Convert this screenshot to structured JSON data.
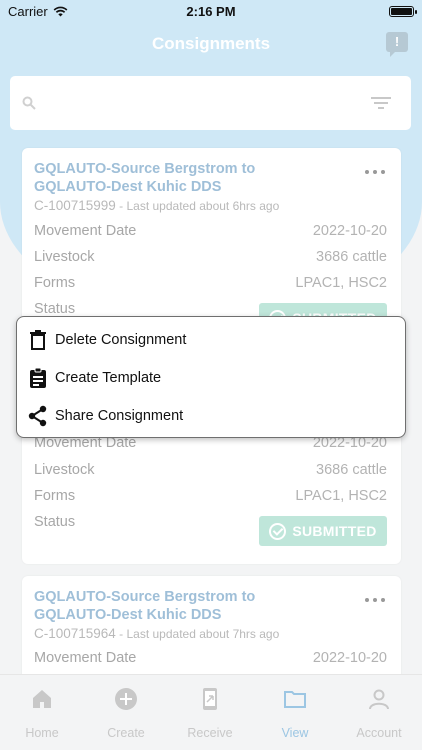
{
  "status_bar": {
    "carrier": "Carrier",
    "time": "2:16 PM"
  },
  "header": {
    "title": "Consignments",
    "chat_icon": "chat-alert-icon",
    "chat_mark": "!"
  },
  "search": {
    "icon": "search-icon",
    "filter_icon": "filter-icon"
  },
  "cards": [
    {
      "title": "GQLAUTO-Source Bergstrom to GQLAUTO-Dest Kuhic DDS",
      "id": "C-100715999",
      "updated": " - Last updated about 6hrs ago",
      "rows": [
        {
          "label": "Movement Date",
          "value": "2022-10-20"
        },
        {
          "label": "Livestock",
          "value": "3686 cattle"
        },
        {
          "label": "Forms",
          "value": "LPAC1, HSC2"
        },
        {
          "label": "Status",
          "value": "SUBMITTED"
        }
      ]
    },
    {
      "rows": [
        {
          "label": "Movement Date",
          "value": "2022-10-20"
        },
        {
          "label": "Livestock",
          "value": "3686 cattle"
        },
        {
          "label": "Forms",
          "value": "LPAC1, HSC2"
        },
        {
          "label": "Status",
          "value": "SUBMITTED"
        }
      ]
    },
    {
      "title": "GQLAUTO-Source Bergstrom to GQLAUTO-Dest Kuhic DDS",
      "id": "C-100715964",
      "updated": " - Last updated about 7hrs ago",
      "rows": [
        {
          "label": "Movement Date",
          "value": "2022-10-20"
        }
      ]
    }
  ],
  "menu": {
    "items": [
      {
        "label": "Delete Consignment",
        "icon": "trash-icon"
      },
      {
        "label": "Create Template",
        "icon": "clipboard-icon"
      },
      {
        "label": "Share Consignment",
        "icon": "share-icon"
      }
    ]
  },
  "tabs": [
    {
      "label": "Home",
      "icon": "home-icon"
    },
    {
      "label": "Create",
      "icon": "plus-circle-icon"
    },
    {
      "label": "Receive",
      "icon": "phone-icon"
    },
    {
      "label": "View",
      "icon": "folder-icon",
      "active": true
    },
    {
      "label": "Account",
      "icon": "user-icon"
    }
  ],
  "colors": {
    "header": "#cfe8f6",
    "title_link": "#9fbfd8",
    "submitted": "#bfe6da",
    "tab_active": "#9cc6e3"
  }
}
